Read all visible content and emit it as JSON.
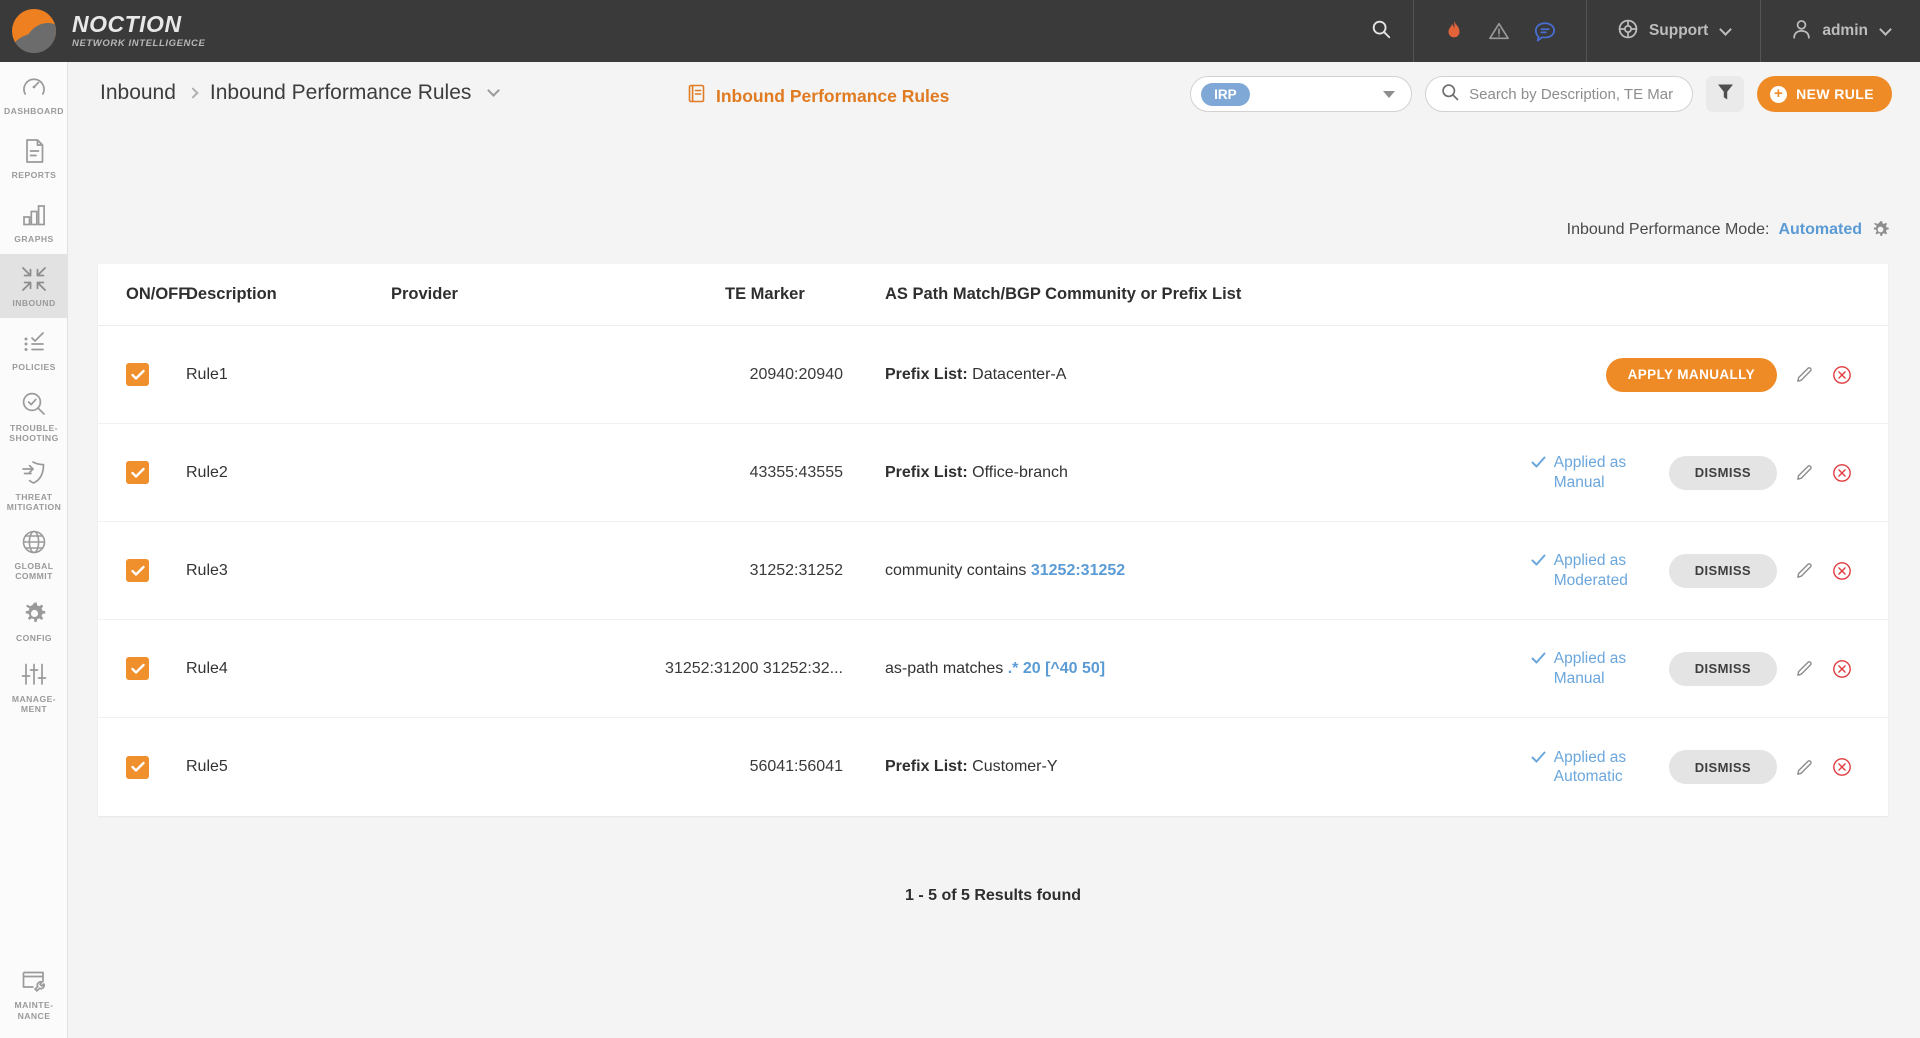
{
  "brand": {
    "name": "NOCTION",
    "tagline": "NETWORK INTELLIGENCE"
  },
  "topbar": {
    "search_icon": "search-icon",
    "icons": [
      {
        "name": "flame-icon",
        "color": "#e2633a"
      },
      {
        "name": "warning-triangle-icon",
        "color": "#9a9a9a"
      },
      {
        "name": "chat-bubble-icon",
        "color": "#4a6fd4"
      }
    ],
    "support_label": "Support",
    "support_icon": "lifebuoy-icon",
    "user_label": "admin",
    "user_icon": "person-icon"
  },
  "sidebar": {
    "items": [
      {
        "label": "DASHBOARD",
        "icon": "gauge-icon",
        "active": false
      },
      {
        "label": "REPORTS",
        "icon": "document-icon",
        "active": false
      },
      {
        "label": "GRAPHS",
        "icon": "bar-chart-icon",
        "active": false
      },
      {
        "label": "INBOUND",
        "icon": "arrows-in-icon",
        "active": true
      },
      {
        "label": "POLICIES",
        "icon": "checklist-icon",
        "active": false
      },
      {
        "label": "TROUBLE-\nSHOOTING",
        "icon": "magnifier-check-icon",
        "active": false
      },
      {
        "label": "THREAT\nMITIGATION",
        "icon": "shield-arrow-icon",
        "active": false
      },
      {
        "label": "GLOBAL\nCOMMIT",
        "icon": "globe-icon",
        "active": false
      },
      {
        "label": "CONFIG",
        "icon": "gear-icon",
        "active": false
      },
      {
        "label": "MANAGE-\nMENT",
        "icon": "sliders-icon",
        "active": false
      }
    ],
    "bottom": {
      "label": "MAINTE-\nNANCE",
      "icon": "wrench-window-icon"
    }
  },
  "breadcrumb": {
    "parent": "Inbound",
    "current": "Inbound Performance Rules",
    "caret_icon": "chevron-down-icon",
    "separator_icon": "chevron-right-icon"
  },
  "page_tab": {
    "label": "Inbound Performance Rules",
    "icon": "rules-book-icon"
  },
  "toolbar": {
    "selector": {
      "value": "IRP",
      "caret_icon": "caret-down-icon"
    },
    "search": {
      "placeholder": "Search by Description, TE Mar",
      "value": "",
      "icon": "search-icon"
    },
    "filter_icon": "funnel-icon",
    "new_rule_label": "NEW RULE",
    "new_rule_icon": "plus-circle-icon"
  },
  "mode": {
    "label": "Inbound Performance Mode:",
    "value": "Automated",
    "gear_icon": "gear-icon",
    "value_color": "#5b9bd5"
  },
  "table": {
    "headers": {
      "onoff": "ON/OFF",
      "description": "Description",
      "provider": "Provider",
      "te_marker": "TE Marker",
      "match": "AS Path Match/BGP Community or Prefix List"
    },
    "rows": [
      {
        "enabled": true,
        "description": "Rule1",
        "provider": "",
        "te_marker": "20940:20940",
        "match_label": "Prefix List:",
        "match_value": "Datacenter-A",
        "match_value_highlight": false,
        "status": "",
        "action_label": "APPLY MANUALLY",
        "action_kind": "apply",
        "edit_icon": "pencil-icon",
        "delete_icon": "delete-circle-icon"
      },
      {
        "enabled": true,
        "description": "Rule2",
        "provider": "",
        "te_marker": "43355:43555",
        "match_label": "Prefix List:",
        "match_value": "Office-branch",
        "match_value_highlight": false,
        "status": "Applied as Manual",
        "action_label": "DISMISS",
        "action_kind": "dismiss",
        "edit_icon": "pencil-icon",
        "delete_icon": "delete-circle-icon"
      },
      {
        "enabled": true,
        "description": "Rule3",
        "provider": "",
        "te_marker": "31252:31252",
        "match_label": "community contains",
        "match_value": "31252:31252",
        "match_value_highlight": true,
        "status": "Applied as Moderated",
        "action_label": "DISMISS",
        "action_kind": "dismiss",
        "edit_icon": "pencil-icon",
        "delete_icon": "delete-circle-icon"
      },
      {
        "enabled": true,
        "description": "Rule4",
        "provider": "",
        "te_marker": "31252:31200 31252:32...",
        "match_label": "as-path matches",
        "match_value": ".* 20 [^40 50]",
        "match_value_highlight": true,
        "status": "Applied as Manual",
        "action_label": "DISMISS",
        "action_kind": "dismiss",
        "edit_icon": "pencil-icon",
        "delete_icon": "delete-circle-icon"
      },
      {
        "enabled": true,
        "description": "Rule5",
        "provider": "",
        "te_marker": "56041:56041",
        "match_label": "Prefix List:",
        "match_value": "Customer-Y",
        "match_value_highlight": false,
        "status": "Applied as Automatic",
        "action_label": "DISMISS",
        "action_kind": "dismiss",
        "edit_icon": "pencil-icon",
        "delete_icon": "delete-circle-icon"
      }
    ],
    "results_text": "1 - 5 of 5 Results found"
  },
  "colors": {
    "accent_orange": "#ef8b26",
    "link_blue": "#5b9bd5",
    "header_dark": "#3a3a3a",
    "delete_red": "#e0393e"
  }
}
